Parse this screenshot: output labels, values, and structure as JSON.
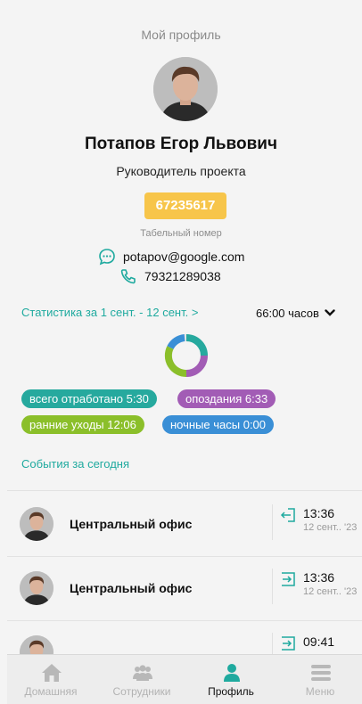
{
  "header": {
    "title": "Мой профиль"
  },
  "profile": {
    "name": "Потапов Егор  Львович",
    "position": "Руководитель проекта",
    "personnel_number": "67235617",
    "personnel_caption": "Табельный номер",
    "email": "potapov@google.com",
    "phone": "79321289038"
  },
  "stats": {
    "link": "Статистика за 1 сент. - 12 сент. >",
    "hours": "66:00 часов",
    "donut_colors": [
      "#26a99e",
      "#a25cb5",
      "#8bbf2a",
      "#3a8fd6"
    ],
    "pills": {
      "worked": "всего отработано 5:30",
      "late": "опоздания 6:33",
      "early": "ранние уходы 12:06",
      "night": "ночные часы 0:00"
    }
  },
  "events": {
    "link": "События за сегодня",
    "items": [
      {
        "title": "Центральный офис",
        "time": "13:36",
        "date": "12 сент.. '23",
        "icon": "exit-icon"
      },
      {
        "title": "Центральный офис",
        "time": "13:36",
        "date": "12 сент.. '23",
        "icon": "enter-icon"
      },
      {
        "title": "",
        "time": "09:41",
        "date": "",
        "icon": "enter-icon"
      }
    ]
  },
  "nav": {
    "home": "Домашняя",
    "employees": "Сотрудники",
    "profile": "Профиль",
    "menu": "Меню"
  },
  "colors": {
    "accent": "#1faa9f",
    "badge": "#f7c54a"
  }
}
